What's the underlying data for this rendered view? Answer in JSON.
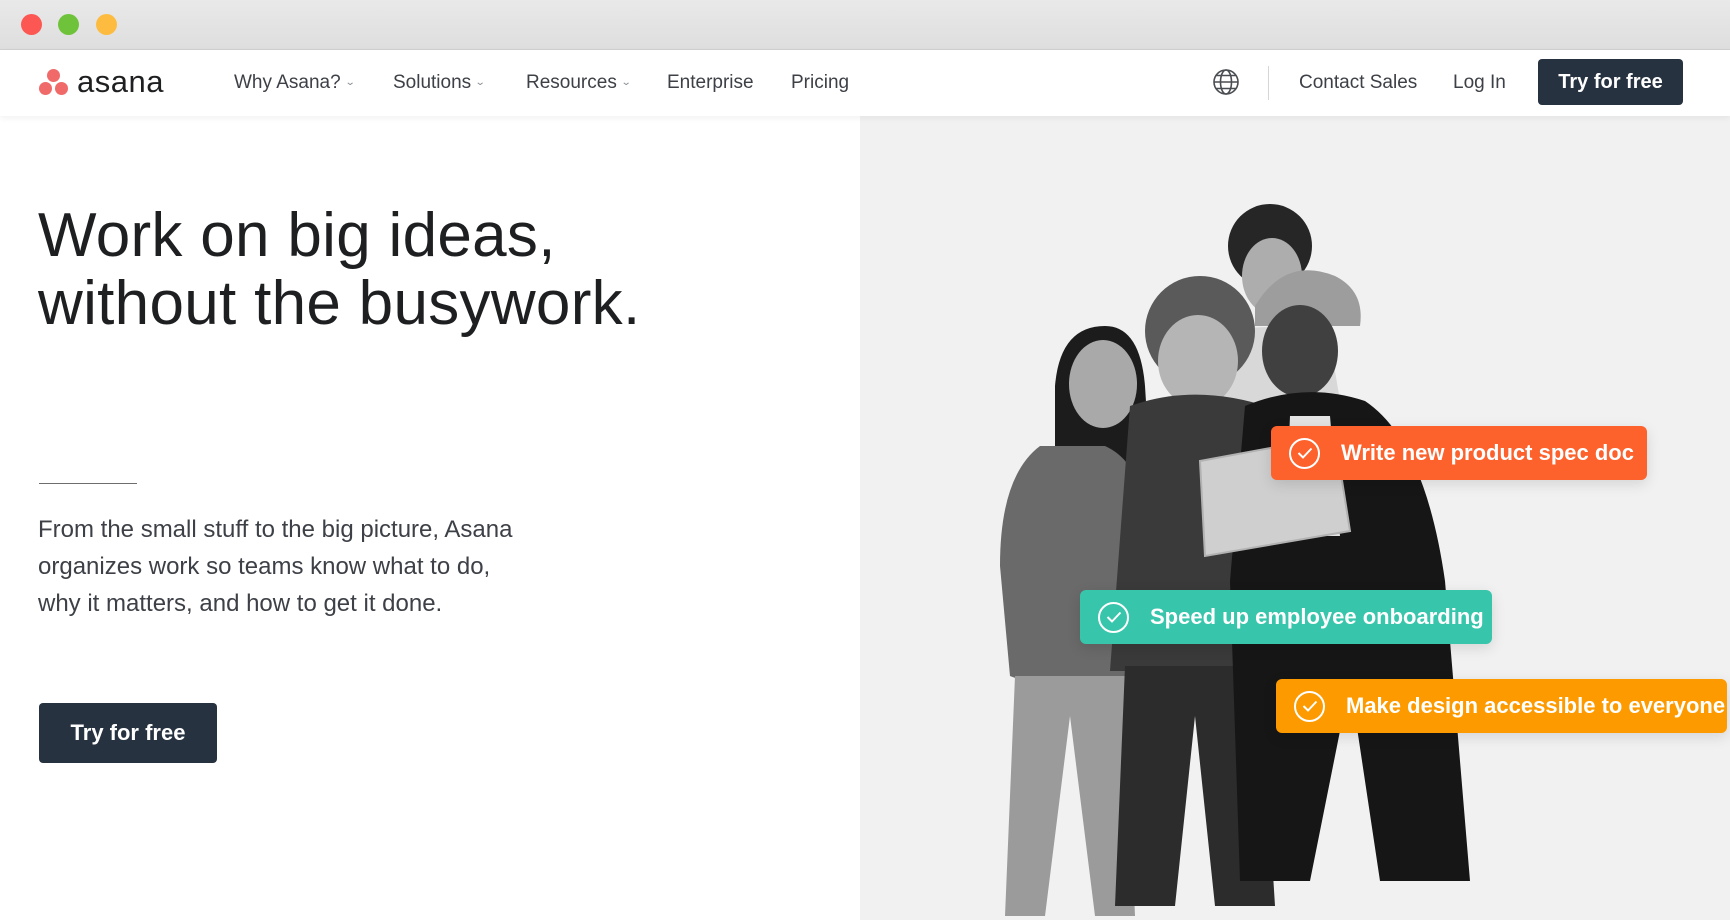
{
  "brand": {
    "name": "asana",
    "accent_color": "#f06a6a",
    "dark_color": "#273240"
  },
  "nav": {
    "items": [
      {
        "label": "Why Asana?",
        "has_dropdown": true
      },
      {
        "label": "Solutions",
        "has_dropdown": true
      },
      {
        "label": "Resources",
        "has_dropdown": true
      },
      {
        "label": "Enterprise",
        "has_dropdown": false
      },
      {
        "label": "Pricing",
        "has_dropdown": false
      }
    ],
    "language_icon": "globe-icon",
    "contact_sales": "Contact Sales",
    "login": "Log In",
    "cta": "Try for free"
  },
  "hero": {
    "headline_line1": "Work on big ideas,",
    "headline_line2": "without the busywork.",
    "subtext_line1": "From the small stuff to the big picture, Asana",
    "subtext_line2": "organizes work so teams know what to do,",
    "subtext_line3": "why it matters, and how to get it done.",
    "cta": "Try for free"
  },
  "tasks": [
    {
      "label": "Write new product spec doc",
      "color": "#fd612c",
      "icon": "check-circle-icon"
    },
    {
      "label": "Speed up employee onboarding",
      "color": "#37c5ab",
      "icon": "check-circle-icon"
    },
    {
      "label": "Make design accessible to everyone",
      "color": "#fd9a00",
      "icon": "check-circle-icon"
    }
  ]
}
